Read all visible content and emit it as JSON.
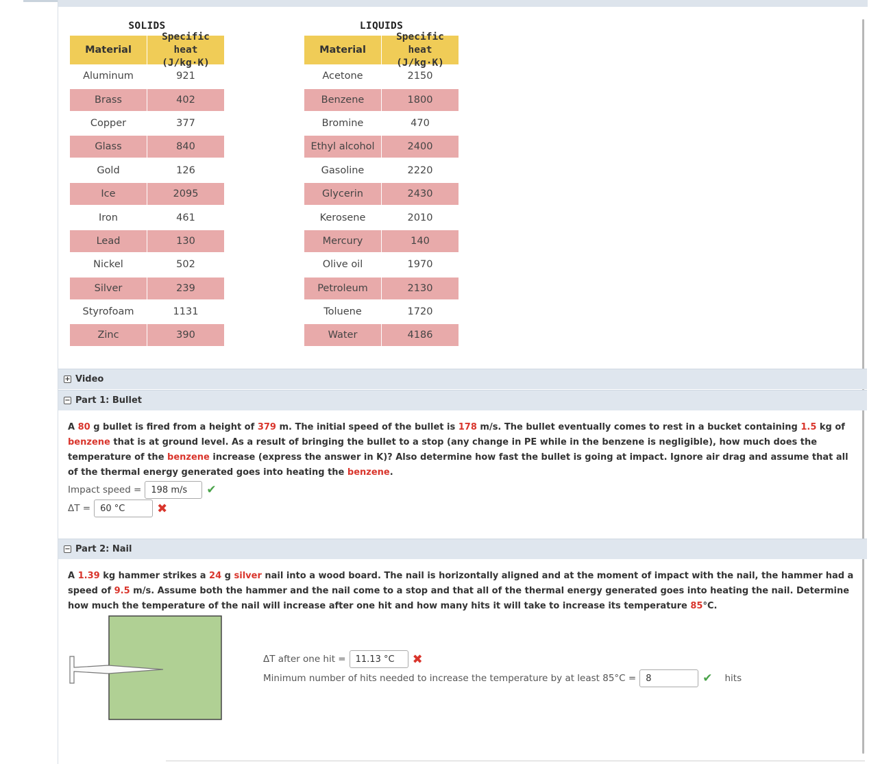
{
  "solids": {
    "title": "SOLIDS",
    "header_material": "Material",
    "header_specific_heat_1": "Specific heat",
    "header_specific_heat_2": "(J/kg·K)",
    "rows": [
      {
        "material": "Aluminum",
        "value": "921"
      },
      {
        "material": "Brass",
        "value": "402"
      },
      {
        "material": "Copper",
        "value": "377"
      },
      {
        "material": "Glass",
        "value": "840"
      },
      {
        "material": "Gold",
        "value": "126"
      },
      {
        "material": "Ice",
        "value": "2095"
      },
      {
        "material": "Iron",
        "value": "461"
      },
      {
        "material": "Lead",
        "value": "130"
      },
      {
        "material": "Nickel",
        "value": "502"
      },
      {
        "material": "Silver",
        "value": "239"
      },
      {
        "material": "Styrofoam",
        "value": "1131"
      },
      {
        "material": "Zinc",
        "value": "390"
      }
    ]
  },
  "liquids": {
    "title": "LIQUIDS",
    "header_material": "Material",
    "header_specific_heat_1": "Specific heat",
    "header_specific_heat_2": "(J/kg·K)",
    "rows": [
      {
        "material": "Acetone",
        "value": "2150"
      },
      {
        "material": "Benzene",
        "value": "1800"
      },
      {
        "material": "Bromine",
        "value": "470"
      },
      {
        "material": "Ethyl alcohol",
        "value": "2400"
      },
      {
        "material": "Gasoline",
        "value": "2220"
      },
      {
        "material": "Glycerin",
        "value": "2430"
      },
      {
        "material": "Kerosene",
        "value": "2010"
      },
      {
        "material": "Mercury",
        "value": "140"
      },
      {
        "material": "Olive oil",
        "value": "1970"
      },
      {
        "material": "Petroleum",
        "value": "2130"
      },
      {
        "material": "Toluene",
        "value": "1720"
      },
      {
        "material": "Water",
        "value": "4186"
      }
    ]
  },
  "sections": {
    "video_label": "Video",
    "video_toggle": "+",
    "part1_label": "Part 1: Bullet",
    "part1_toggle": "−",
    "part2_label": "Part 2: Nail",
    "part2_toggle": "−"
  },
  "part1": {
    "t1": "A ",
    "mass": "80",
    "t2": " g bullet is fired from a height of ",
    "height": "379",
    "t3": " m. The initial speed of the bullet is ",
    "speed": "178",
    "t4": " m/s. The bullet eventually comes to rest in a bucket containing ",
    "liquid_mass": "1.5",
    "t5": " kg of ",
    "liquid1": "benzene",
    "t6": " that is at ground level. As a result of bringing the bullet to a stop (any change in PE while in the benzene is negligible), how much does the temperature of the ",
    "liquid2": "benzene",
    "t7": " increase (express the answer in K)? Also determine how fast the bullet is going at impact. Ignore air drag and assume that all of the thermal energy generated goes into heating the ",
    "liquid3": "benzene",
    "t8": ".",
    "impact_label": "Impact speed =",
    "impact_value": "198 m/s",
    "dt_label": "ΔT =",
    "dt_value": "60 °C"
  },
  "part2": {
    "t1": "A ",
    "hammer_mass": "1.39",
    "t2": " kg hammer strikes a ",
    "nail_mass": "24",
    "t3": " g ",
    "metal": "silver",
    "t4": " nail into a wood board. The nail is horizontally aligned and at the moment of impact with the nail, the hammer had a speed of ",
    "hammer_speed": "9.5",
    "t5": " m/s. Assume both the hammer and the nail come to a stop and that all of the thermal energy generated goes into heating the nail. Determine how much the temperature of the nail will increase after one hit and how many hits it will take to increase its temperature ",
    "target_temp": "85",
    "t6": "°C.",
    "dt_label": "ΔT after one hit =",
    "dt_value": "11.13 °C",
    "hits_label": "Minimum number of hits needed to increase the temperature by at least 85°C =",
    "hits_value": "8",
    "hits_unit": "hits"
  },
  "status": {
    "correct": "✔",
    "incorrect": "✖"
  },
  "colors": {
    "header_yellow": "#f0cc57",
    "row_pink": "#e8aaaa",
    "highlight_red": "#d9352c",
    "section_bar": "#dfe6ee",
    "board_green": "#b0d094"
  }
}
